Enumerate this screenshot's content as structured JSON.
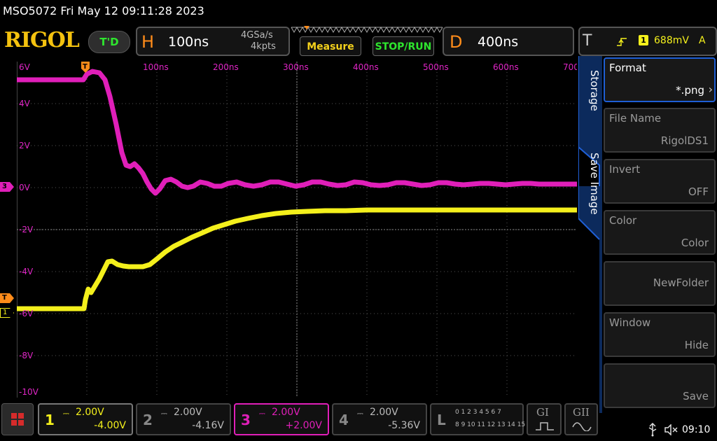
{
  "title": "MSO5072  Fri May 12 09:11:28 2023",
  "brand": "RIGOL",
  "trigger_status": "T'D",
  "horizontal": {
    "letter": "H",
    "scale": "100ns",
    "sample_rate": "4GSa/s",
    "points": "4kpts"
  },
  "measure_label": "Measure",
  "run_label": "STOP/RUN",
  "delay": {
    "letter": "D",
    "value": "400ns"
  },
  "trigger": {
    "letter": "T",
    "source": "1",
    "level": "688mV",
    "mode": "A"
  },
  "time_labels": [
    "100ns",
    "200ns",
    "300ns",
    "400ns",
    "500ns",
    "600ns",
    "700"
  ],
  "volt_labels": [
    "6V",
    "4V",
    "2V",
    "0V",
    "-2V",
    "-4V",
    "-6V",
    "-8V",
    "-10V"
  ],
  "markers": {
    "ch3": "3",
    "trigger": "T",
    "ch1": "1",
    "trigger_top": "T"
  },
  "side_tabs": {
    "storage": "Storage",
    "save_image": "Save Image"
  },
  "side_menu": [
    {
      "title": "Format",
      "value": "*.png"
    },
    {
      "title": "File Name",
      "value": "RigolDS1"
    },
    {
      "title": "Invert",
      "value": "OFF"
    },
    {
      "title": "Color",
      "value": "Color"
    },
    {
      "title": "",
      "value": "NewFolder"
    },
    {
      "title": "Window",
      "value": "Hide"
    },
    {
      "title": "",
      "value": "Save"
    }
  ],
  "channels": [
    {
      "num": "1",
      "scale": "2.00V",
      "offset": "-4.00V"
    },
    {
      "num": "2",
      "scale": "2.00V",
      "offset": "-4.16V"
    },
    {
      "num": "3",
      "scale": "2.00V",
      "offset": "+2.00V"
    },
    {
      "num": "4",
      "scale": "2.00V",
      "offset": "-5.36V"
    }
  ],
  "logic": {
    "letter": "L",
    "row1": "0 1 2 3  4 5 6 7",
    "row2": "8 9 10 11 12 13 14 15"
  },
  "gen1": "GI",
  "gen2": "GII",
  "clock": "09:10",
  "colors": {
    "ch1": "#f4f01c",
    "ch3": "#e01fb9",
    "accent": "#ff8c1a",
    "menu_border": "#1f5fd6"
  }
}
